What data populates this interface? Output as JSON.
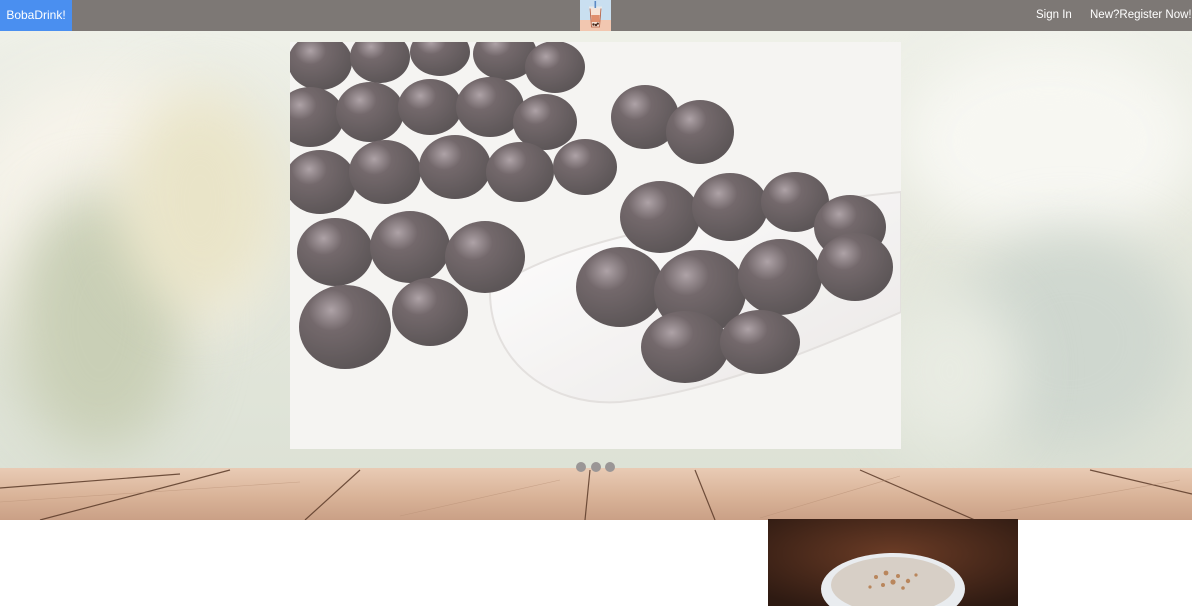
{
  "navbar": {
    "brand": "BobaDrink!",
    "sign_in": "Sign In",
    "register": "New?Register Now!"
  },
  "carousel": {
    "slide_count": 3,
    "active_slide": 1
  },
  "colors": {
    "navbar_bg": "#7d7875",
    "brand_bg": "#4a8ff0",
    "indicator_dot": "#9a9696"
  }
}
